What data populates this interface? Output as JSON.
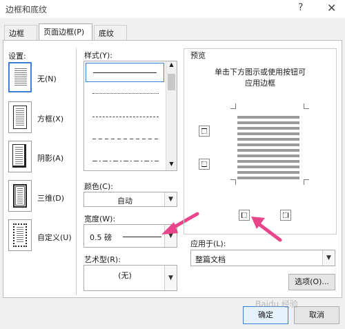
{
  "window": {
    "title": "边框和底纹",
    "help_icon": "?",
    "close_icon": "✕"
  },
  "tabs": [
    {
      "label": "边框(B)",
      "active": false
    },
    {
      "label": "页面边框(P)",
      "active": true
    },
    {
      "label": "底纹(S)",
      "active": false
    }
  ],
  "settings": {
    "heading": "设置:",
    "items": [
      {
        "label": "无(N)",
        "selected": true
      },
      {
        "label": "方框(X)",
        "selected": false
      },
      {
        "label": "阴影(A)",
        "selected": false
      },
      {
        "label": "三维(D)",
        "selected": false
      },
      {
        "label": "自定义(U)",
        "selected": false
      }
    ]
  },
  "style": {
    "heading": "样式(Y):"
  },
  "color": {
    "heading": "颜色(C):",
    "value": "自动"
  },
  "width": {
    "heading": "宽度(W):",
    "value": "0.5 磅"
  },
  "art": {
    "heading": "艺术型(R):",
    "value": "(无)"
  },
  "preview": {
    "heading": "预览",
    "hint_line1": "单击下方图示或使用按钮可",
    "hint_line2": "应用边框"
  },
  "apply": {
    "heading": "应用于(L):",
    "value": "整篇文档"
  },
  "buttons": {
    "options": "选项(O)...",
    "ok": "确定",
    "cancel": "取消"
  },
  "watermark": "Baidu 经验"
}
